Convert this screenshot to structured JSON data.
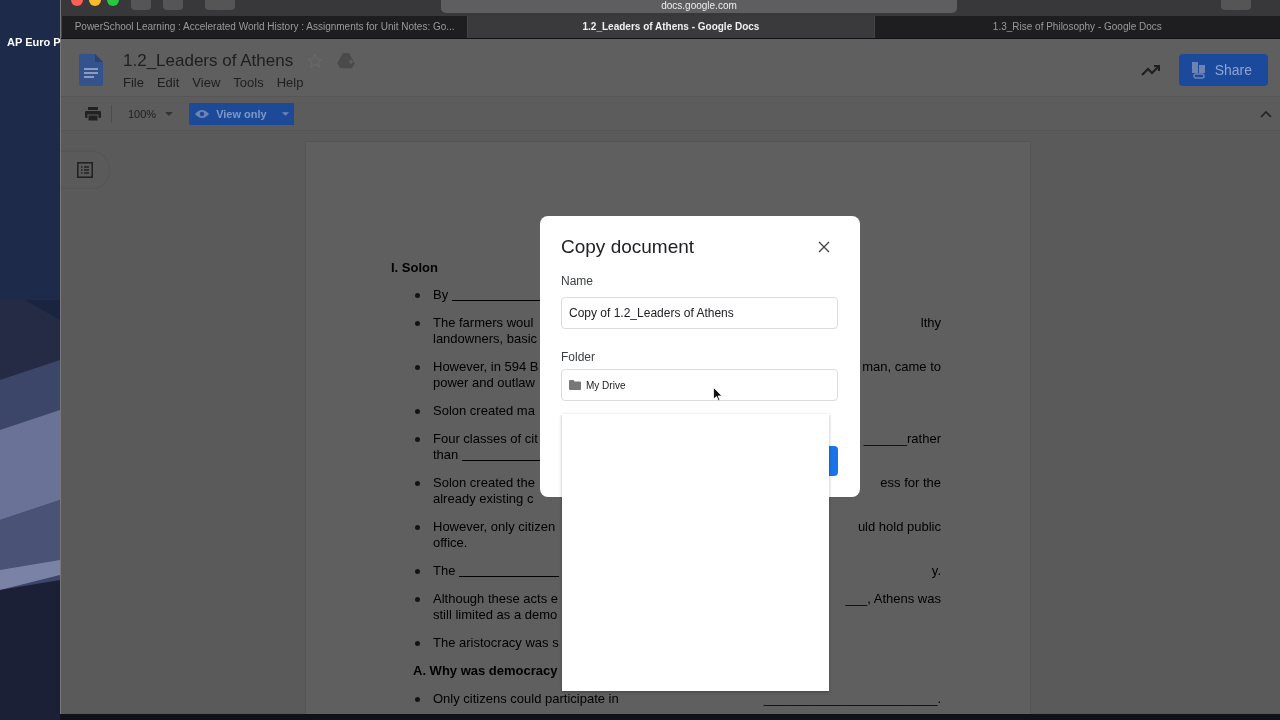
{
  "desktop": {
    "icon_label": "AP Euro P"
  },
  "browser": {
    "address": "docs.google.com",
    "tabs": [
      {
        "title": "PowerSchool Learning : Accelerated World History : Assignments for Unit Notes: Go...",
        "selected": false
      },
      {
        "title": "1.2_Leaders of Athens - Google Docs",
        "selected": true
      },
      {
        "title": "1.3_Rise of Philosophy - Google Docs",
        "selected": false
      }
    ]
  },
  "docs": {
    "title": "1.2_Leaders of Athens",
    "menu": [
      "File",
      "Edit",
      "View",
      "Tools",
      "Help"
    ],
    "zoom": "100%",
    "mode_button": "View only",
    "share_button": "Share"
  },
  "document": {
    "blocks": [
      {
        "kind": "heading",
        "lines": [
          {
            "left": "I. Solon"
          }
        ]
      },
      {
        "kind": "bullet",
        "lines": [
          {
            "left": "By",
            "blank": true
          }
        ]
      },
      {
        "kind": "bullet",
        "lines": [
          {
            "left": "The farmers woul",
            "right": "lthy"
          },
          {
            "left": "landowners, basic"
          }
        ]
      },
      {
        "kind": "bullet",
        "lines": [
          {
            "left": "However, in 594 B",
            "right": "man, came to"
          },
          {
            "left": "power and outlaw"
          }
        ]
      },
      {
        "kind": "bullet",
        "lines": [
          {
            "left": "Solon created ma"
          }
        ]
      },
      {
        "kind": "bullet",
        "lines": [
          {
            "left": "Four classes of cit",
            "right": "______rather"
          },
          {
            "left": "than",
            "blank": true
          }
        ]
      },
      {
        "kind": "bullet",
        "lines": [
          {
            "left": "Solon created the",
            "right": "ess for the"
          },
          {
            "left": "already existing c"
          }
        ]
      },
      {
        "kind": "bullet",
        "lines": [
          {
            "left": "However, only citizen",
            "right": "uld hold public"
          },
          {
            "left": "office."
          }
        ]
      },
      {
        "kind": "bullet",
        "lines": [
          {
            "left": "The",
            "blank": true,
            "right": "y."
          }
        ]
      },
      {
        "kind": "bullet",
        "lines": [
          {
            "left": "Although these acts e",
            "right": "___, Athens was"
          },
          {
            "left": "still limited as a demo"
          }
        ]
      },
      {
        "kind": "bullet",
        "lines": [
          {
            "left": "The aristocracy was s"
          }
        ]
      },
      {
        "kind": "subheading",
        "lines": [
          {
            "left": "A. Why was democracy"
          }
        ]
      },
      {
        "kind": "bullet",
        "lines": [
          {
            "left": "Only citizens could participate in",
            "right": "________________________."
          }
        ]
      }
    ]
  },
  "dialog": {
    "title": "Copy document",
    "name_label": "Name",
    "name_value": "Copy of 1.2_Leaders of Athens",
    "folder_label": "Folder",
    "folder_value": "My Drive"
  }
}
